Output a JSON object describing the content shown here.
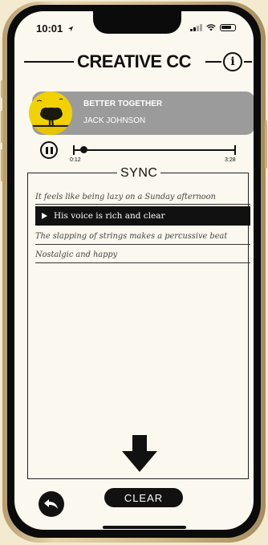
{
  "status": {
    "time": "10:01",
    "location_icon": "location-arrow-icon"
  },
  "app": {
    "title": "CREATIVE CC",
    "info_glyph": "i"
  },
  "track": {
    "title": "BETTER TOGETHER",
    "artist": "JACK JOHNSON",
    "elapsed": "0:12",
    "duration": "3:28",
    "progress": 0.06
  },
  "sync": {
    "title": "SYNC",
    "captions": [
      {
        "text": "It feels like being lazy on a Sunday afternoon"
      },
      {
        "text": "His voice is rich and clear"
      },
      {
        "text": "The slapping of strings makes a percussive beat"
      },
      {
        "text": "Nostalgic and happy"
      }
    ]
  },
  "controls": {
    "clear_label": "CLEAR"
  },
  "colors": {
    "background": "#fbf8ef",
    "accent": "#111111",
    "card": "#9b9b9b",
    "album": "#f1d200"
  }
}
